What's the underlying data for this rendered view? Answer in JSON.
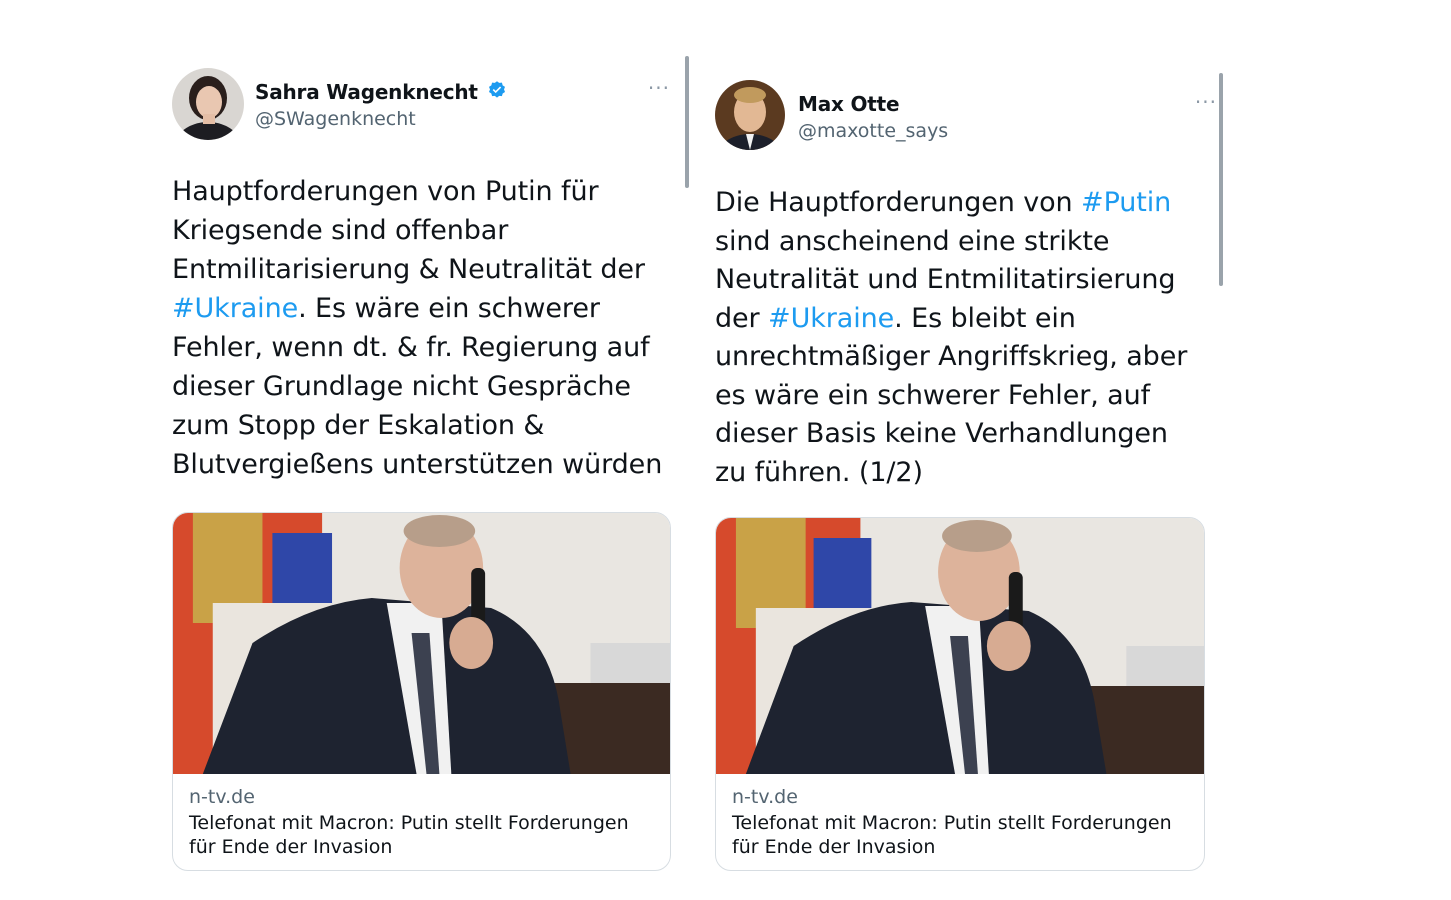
{
  "tweets": [
    {
      "display_name": "Sahra Wagenknecht",
      "handle": "@SWagenknecht",
      "verified": true,
      "more_label": "···",
      "text_parts": [
        "Hauptforderungen von Putin für Kriegsende sind offenbar Entmilitarisierung & Neutralität der ",
        "#Ukraine",
        ". Es wäre ein schwerer Fehler, wenn dt. & fr. Regierung auf dieser Grundlage nicht Gespräche zum Stopp der Eskalation & Blutvergießens unterstützen würden"
      ],
      "card": {
        "domain": "n-tv.de",
        "title": "Telefonat mit Macron: Putin stellt Forderungen für Ende der Invasion"
      }
    },
    {
      "display_name": "Max Otte",
      "handle": "@maxotte_says",
      "verified": false,
      "more_label": "···",
      "text_parts": [
        "Die Hauptforderungen von ",
        "#Putin",
        " sind anscheinend eine strikte Neutralität und Entmilitatirsierung der ",
        "#Ukraine",
        ". Es bleibt ein unrechtmäßiger Angriffskrieg, aber es wäre ein schwerer Fehler, auf dieser Basis keine Verhandlungen zu führen. (1/2)"
      ],
      "card": {
        "domain": "n-tv.de",
        "title": "Telefonat mit Macron: Putin stellt Forderungen für Ende der Invasion"
      }
    }
  ],
  "colors": {
    "link": "#1d9bf0",
    "verified": "#1d9bf0",
    "secondary_text": "#536471",
    "border": "#d7dde2"
  },
  "icons": [
    "verified-badge-icon",
    "more-options-icon"
  ]
}
